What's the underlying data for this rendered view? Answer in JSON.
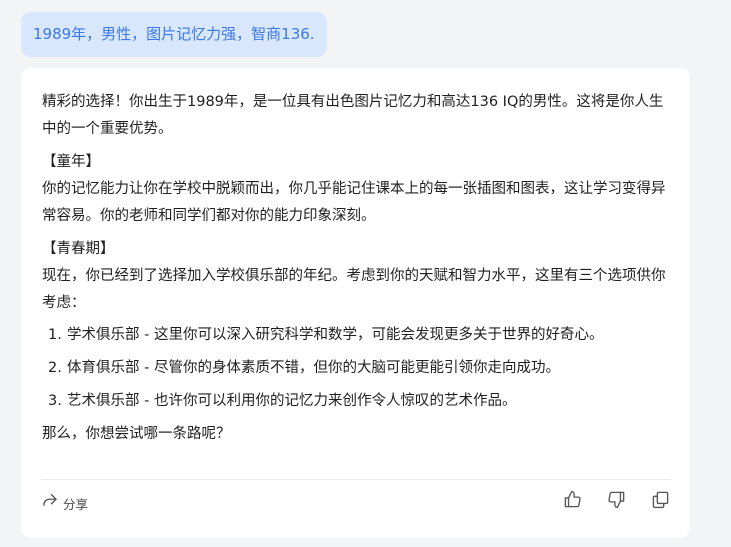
{
  "user_message": "1989年，男性，图片记忆力强，智商136.",
  "answer": {
    "intro": "精彩的选择！你出生于1989年，是一位具有出色图片记忆力和高达136 IQ的男性。这将是你人生中的一个重要优势。",
    "childhood_title": "【童年】",
    "childhood_text": "你的记忆能力让你在学校中脱颖而出，你几乎能记住课本上的每一张插图和图表，这让学习变得异常容易。你的老师和同学们都对你的能力印象深刻。",
    "youth_title": "【青春期】",
    "youth_text": "现在，你已经到了选择加入学校俱乐部的年纪。考虑到你的天赋和智力水平，这里有三个选项供你考虑：",
    "options": [
      {
        "num": "1.",
        "text": "学术俱乐部 - 这里你可以深入研究科学和数学，可能会发现更多关于世界的好奇心。"
      },
      {
        "num": "2.",
        "text": "体育俱乐部 - 尽管你的身体素质不错，但你的大脑可能更能引领你走向成功。"
      },
      {
        "num": "3.",
        "text": "艺术俱乐部 - 也许你可以利用你的记忆力来创作令人惊叹的艺术作品。"
      }
    ],
    "closing": "那么，你想尝试哪一条路呢？"
  },
  "footer": {
    "share_label": "分享",
    "share_icon": "share-icon",
    "like_icon": "thumbs-up-icon",
    "dislike_icon": "thumbs-down-icon",
    "copy_icon": "copy-icon"
  },
  "colors": {
    "user_bubble_bg": "#d8e7fd",
    "user_bubble_text": "#3a78e6",
    "page_bg": "#f3f4f6",
    "card_bg": "#ffffff"
  }
}
